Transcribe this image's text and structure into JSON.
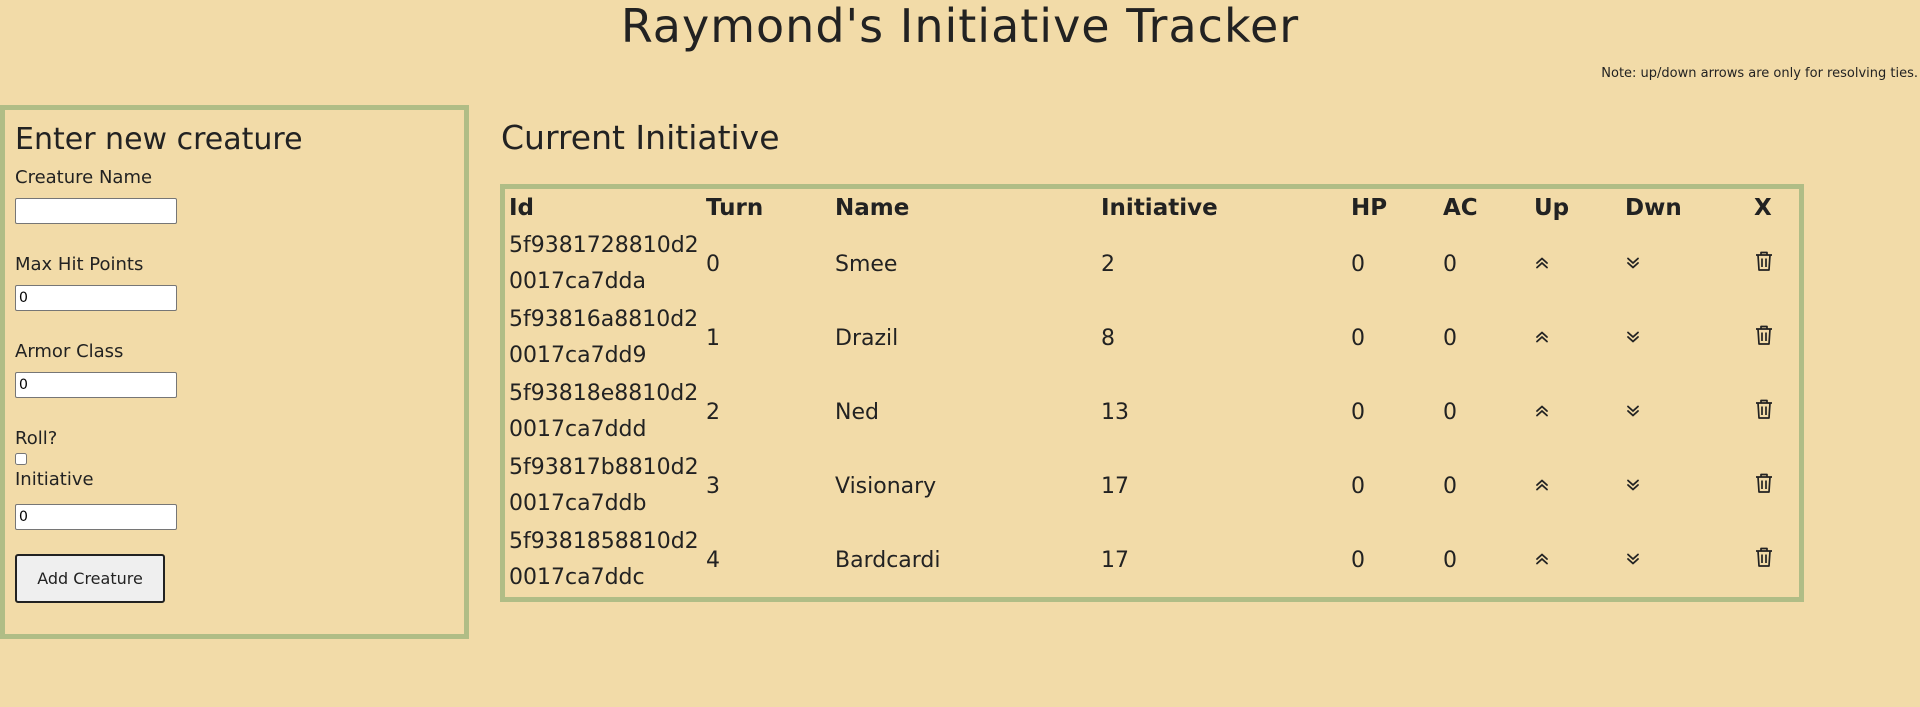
{
  "header": {
    "title": "Raymond's Initiative Tracker",
    "note": "Note: up/down arrows are only for resolving ties."
  },
  "form": {
    "heading": "Enter new creature",
    "name_label": "Creature Name",
    "name_value": "",
    "hp_label": "Max Hit Points",
    "hp_value": "0",
    "ac_label": "Armor Class",
    "ac_value": "0",
    "roll_label": "Roll?",
    "roll_checked": false,
    "initiative_label": "Initiative",
    "initiative_value": "0",
    "submit_label": "Add Creature"
  },
  "initiative": {
    "heading": "Current Initiative",
    "columns": [
      "Id",
      "Turn",
      "Name",
      "Initiative",
      "HP",
      "AC",
      "Up",
      "Dwn",
      "X"
    ],
    "rows": [
      {
        "id": "5f9381728810d20017ca7dda",
        "turn": "0",
        "name": "Smee",
        "initiative": "2",
        "hp": "0",
        "ac": "0"
      },
      {
        "id": "5f93816a8810d20017ca7dd9",
        "turn": "1",
        "name": "Drazil",
        "initiative": "8",
        "hp": "0",
        "ac": "0"
      },
      {
        "id": "5f93818e8810d20017ca7ddd",
        "turn": "2",
        "name": "Ned",
        "initiative": "13",
        "hp": "0",
        "ac": "0"
      },
      {
        "id": "5f93817b8810d20017ca7ddb",
        "turn": "3",
        "name": "Visionary",
        "initiative": "17",
        "hp": "0",
        "ac": "0"
      },
      {
        "id": "5f9381858810d20017ca7ddc",
        "turn": "4",
        "name": "Bardcardi",
        "initiative": "17",
        "hp": "0",
        "ac": "0"
      }
    ]
  },
  "icons": {
    "up": "chevron-double-up-icon",
    "down": "chevron-double-down-icon",
    "delete": "trash-icon"
  },
  "colors": {
    "background": "#f2dba8",
    "panel_border": "#b0bd86",
    "text": "#222222"
  }
}
